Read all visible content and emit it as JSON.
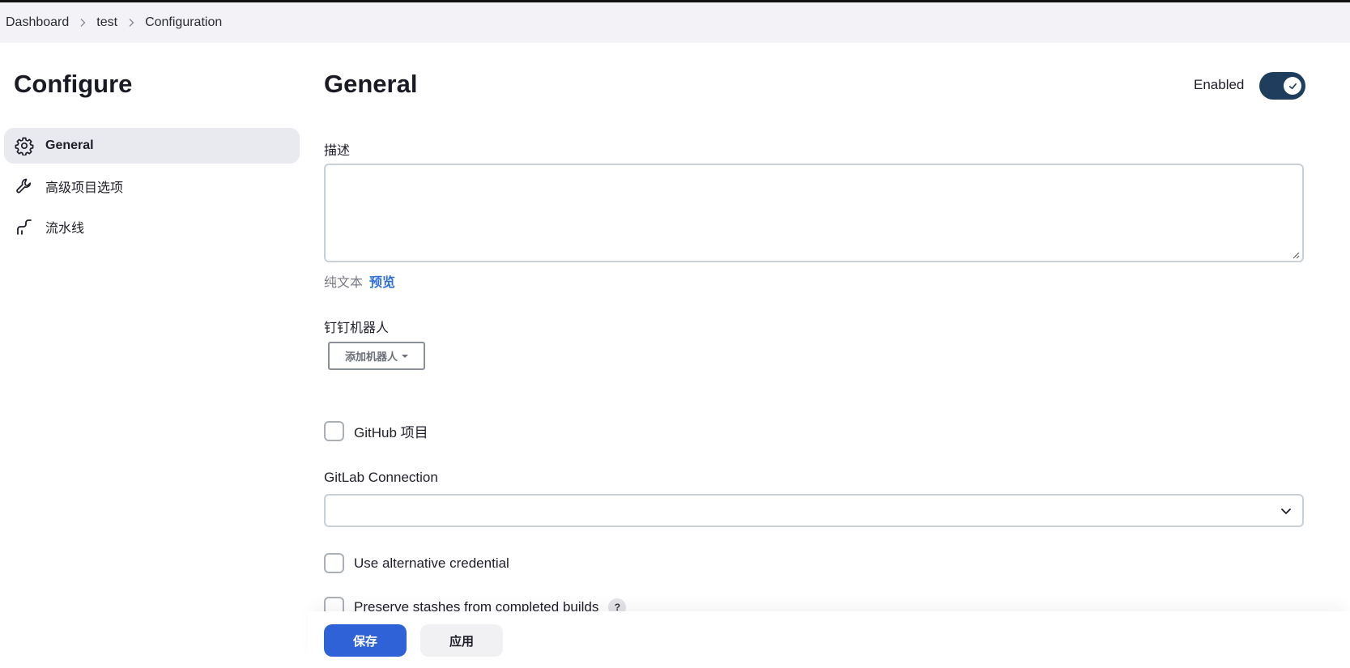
{
  "breadcrumb": {
    "items": [
      "Dashboard",
      "test",
      "Configuration"
    ]
  },
  "sidebar": {
    "title": "Configure",
    "items": [
      {
        "label": "General",
        "icon": "gear-icon",
        "active": true
      },
      {
        "label": "高级项目选项",
        "icon": "wrench-icon",
        "active": false
      },
      {
        "label": "流水线",
        "icon": "pipeline-icon",
        "active": false
      }
    ]
  },
  "main": {
    "title": "General",
    "enabled_label": "Enabled",
    "enabled": true,
    "description": {
      "label": "描述",
      "value": "",
      "plain_text_label": "纯文本",
      "preview_label": "预览"
    },
    "dingtalk": {
      "label": "钉钉机器人",
      "add_button": "添加机器人"
    },
    "github_project": {
      "label": "GitHub 项目",
      "checked": false
    },
    "gitlab_connection": {
      "label": "GitLab Connection",
      "value": ""
    },
    "alt_credential": {
      "label": "Use alternative credential",
      "checked": false
    },
    "preserve_stashes": {
      "label": "Preserve stashes from completed builds",
      "help": "?",
      "checked": false
    }
  },
  "footer": {
    "save_label": "保存",
    "apply_label": "应用"
  },
  "colors": {
    "accent": "#2f62d6",
    "toggle": "#1f3d5c",
    "link": "#2f6fdc"
  }
}
